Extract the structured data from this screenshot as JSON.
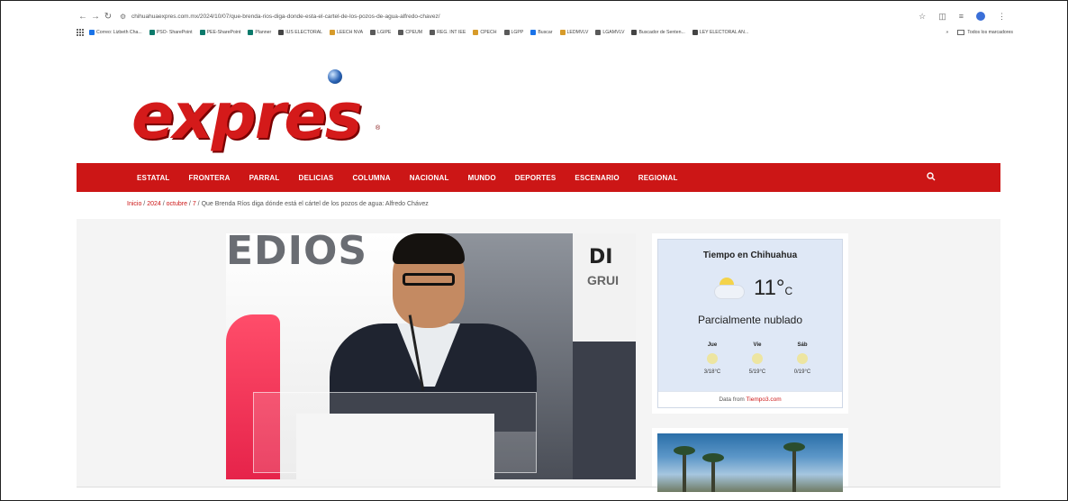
{
  "browser": {
    "url": "chihuahuaexpres.com.mx/2024/10/07/que-brenda-rios-diga-donde-esta-el-cartel-de-los-pozos-de-agua-alfredo-chavez/",
    "nav_icons": [
      "back-icon",
      "forward-icon",
      "reload-icon"
    ],
    "bookmarks": [
      {
        "label": "Correo: Lizbeth Cha...",
        "color": "#1a73e8"
      },
      {
        "label": "PSO- SharePoint",
        "color": "#0b7a6b"
      },
      {
        "label": "PEE-SharePoint",
        "color": "#0b7a6b"
      },
      {
        "label": "Planner",
        "color": "#0b7a6b"
      },
      {
        "label": "IUS ELECTORAL",
        "color": "#444444"
      },
      {
        "label": "LEECH NVA",
        "color": "#d79b2a"
      },
      {
        "label": "LGIPE",
        "color": "#5a5a5a"
      },
      {
        "label": "CPEUM",
        "color": "#5a5a5a"
      },
      {
        "label": "REG. INT IEE",
        "color": "#5a5a5a"
      },
      {
        "label": "CPECH",
        "color": "#d79b2a"
      },
      {
        "label": "LGPP",
        "color": "#5a5a5a"
      },
      {
        "label": "Buscar",
        "color": "#1a73e8"
      },
      {
        "label": "LEDMVLV",
        "color": "#d79b2a"
      },
      {
        "label": "LGAMVLV",
        "color": "#5a5a5a"
      },
      {
        "label": "Buscador de Senten...",
        "color": "#444444"
      },
      {
        "label": "LEY ELECTORAL AN...",
        "color": "#444444"
      }
    ],
    "more": "»",
    "all_bookmarks": "Todos los marcadores"
  },
  "site": {
    "logo_text": "expres",
    "logo_reg": "®",
    "nav": [
      "ESTATAL",
      "FRONTERA",
      "PARRAL",
      "DELICIAS",
      "COLUMNA",
      "NACIONAL",
      "MUNDO",
      "DEPORTES",
      "ESCENARIO",
      "REGIONAL"
    ],
    "accent_color": "#cc1616"
  },
  "breadcrumb": {
    "inicio": "Inicio",
    "year": "2024",
    "month": "octubre",
    "day": "7",
    "current": "Que Brenda Ríos diga dónde está el cártel de los pozos de agua: Alfredo Chávez",
    "sep": " / "
  },
  "photo": {
    "wall_text": "EDIOS",
    "panel_text": "DI",
    "panel_text2": "GRUI"
  },
  "weather": {
    "title": "Tiempo en Chihuahua",
    "temp": "11",
    "unit_deg": "°",
    "unit_c": "C",
    "condition": "Parcialmente nublado",
    "days": [
      {
        "name": "Jue",
        "range": "3/18°C"
      },
      {
        "name": "Vie",
        "range": "5/19°C"
      },
      {
        "name": "Sáb",
        "range": "0/19°C"
      }
    ],
    "footer_prefix": "Data from ",
    "footer_link": "Tiempo3.com"
  }
}
